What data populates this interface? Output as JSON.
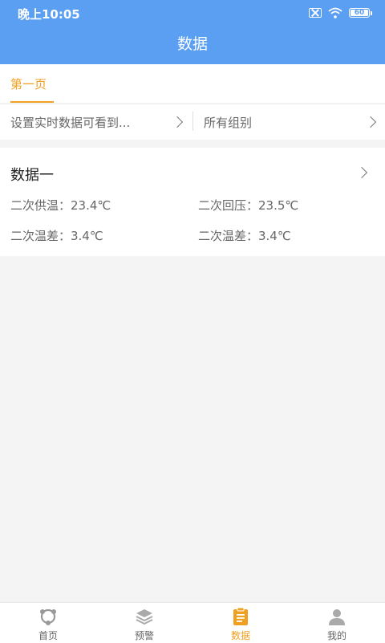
{
  "status_bar": {
    "time": "晚上10:05",
    "battery": "60"
  },
  "header": {
    "title": "数据"
  },
  "tabs": [
    {
      "label": "第一页",
      "active": true
    }
  ],
  "filters": {
    "left_label": "设置实时数据可看到...",
    "right_label": "所有组别"
  },
  "cards": [
    {
      "title": "数据一",
      "fields": [
        "二次供温：23.4℃",
        "二次回压：23.5℃",
        "二次温差：3.4℃",
        "二次温差：3.4℃"
      ]
    }
  ],
  "bottom_nav": [
    {
      "label": "首页",
      "icon": "home-icon"
    },
    {
      "label": "预警",
      "icon": "layers-icon"
    },
    {
      "label": "数据",
      "icon": "clipboard-icon",
      "active": true
    },
    {
      "label": "我的",
      "icon": "user-icon"
    }
  ],
  "colors": {
    "primary": "#5b9ff2",
    "accent": "#f0a020",
    "background": "#f4f4f4"
  }
}
